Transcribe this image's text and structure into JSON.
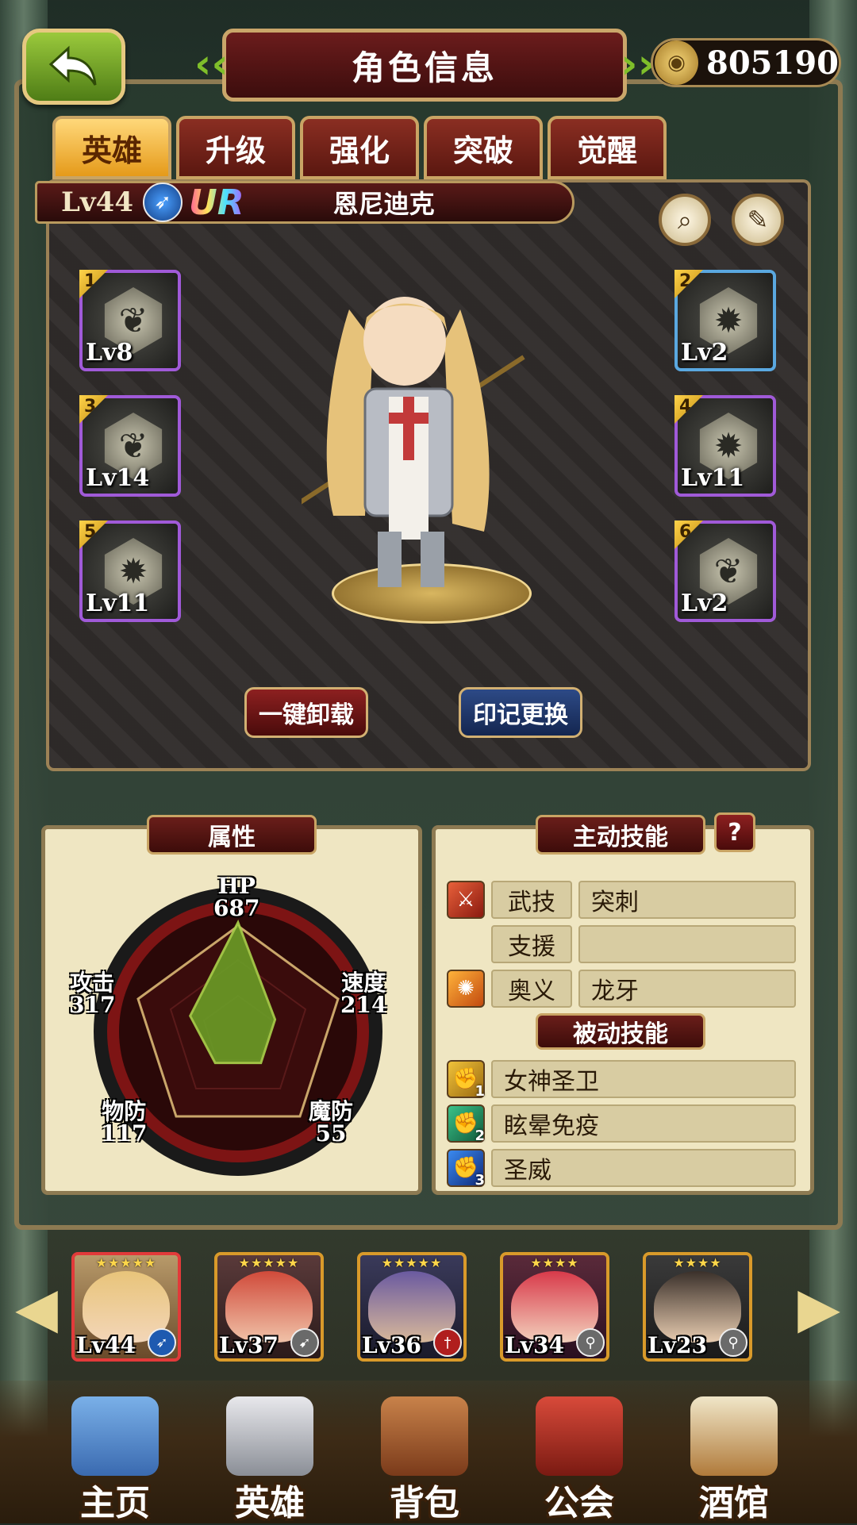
{
  "header": {
    "title": "角色信息",
    "coins": "805190"
  },
  "tabs": [
    {
      "label": "英雄",
      "active": true
    },
    {
      "label": "升级",
      "active": false
    },
    {
      "label": "强化",
      "active": false
    },
    {
      "label": "突破",
      "active": false
    },
    {
      "label": "觉醒",
      "active": false
    }
  ],
  "hero": {
    "level": "Lv44",
    "rarity": "UR",
    "name": "恩尼迪克",
    "class_icon": "spear-icon"
  },
  "slots": [
    {
      "num": "1",
      "level": "Lv8"
    },
    {
      "num": "2",
      "level": "Lv2"
    },
    {
      "num": "3",
      "level": "Lv14"
    },
    {
      "num": "4",
      "level": "Lv11"
    },
    {
      "num": "5",
      "level": "Lv11"
    },
    {
      "num": "6",
      "level": "Lv2"
    }
  ],
  "actions": {
    "unequip_all": "一键卸载",
    "change_mark": "印记更换"
  },
  "attributes": {
    "header": "属性",
    "hp": {
      "label": "HP",
      "value": "687"
    },
    "attack": {
      "label": "攻击",
      "value": "317"
    },
    "speed": {
      "label": "速度",
      "value": "214"
    },
    "mdef": {
      "label": "魔防",
      "value": "55"
    },
    "pdef": {
      "label": "物防",
      "value": "117"
    }
  },
  "skills": {
    "active_header": "主动技能",
    "help": "?",
    "active": [
      {
        "type": "武技",
        "name": "突刺"
      },
      {
        "type": "支援",
        "name": ""
      },
      {
        "type": "奥义",
        "name": "龙牙"
      }
    ],
    "passive_header": "被动技能",
    "passive": [
      {
        "index": "1",
        "name": "女神圣卫"
      },
      {
        "index": "2",
        "name": "眩晕免疫"
      },
      {
        "index": "3",
        "name": "圣威"
      }
    ]
  },
  "roster": [
    {
      "level": "Lv44",
      "stars": "★★★★★"
    },
    {
      "level": "Lv37",
      "stars": "★★★★★"
    },
    {
      "level": "Lv36",
      "stars": "★★★★★"
    },
    {
      "level": "Lv34",
      "stars": "★★★★"
    },
    {
      "level": "Lv23",
      "stars": "★★★★"
    }
  ],
  "nav": [
    {
      "label": "主页"
    },
    {
      "label": "英雄"
    },
    {
      "label": "背包"
    },
    {
      "label": "公会"
    },
    {
      "label": "酒馆"
    }
  ]
}
